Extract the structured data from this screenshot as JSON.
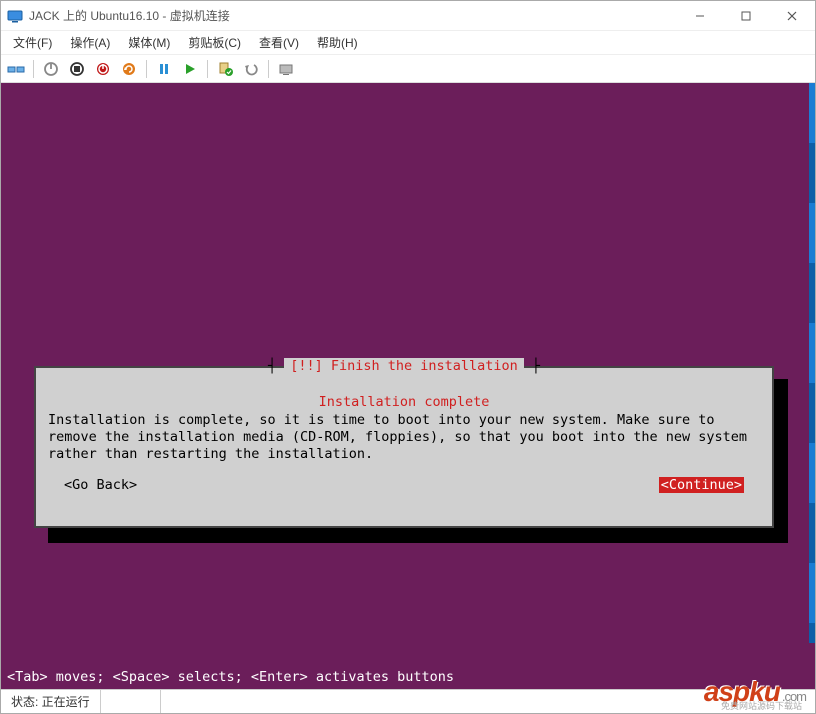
{
  "window": {
    "title": "JACK 上的 Ubuntu16.10 - 虚拟机连接"
  },
  "menu": {
    "file": "文件(F)",
    "operate": "操作(A)",
    "media": "媒体(M)",
    "clipboard": "剪贴板(C)",
    "view": "查看(V)",
    "help": "帮助(H)"
  },
  "installer": {
    "dialog_title": "[!!] Finish the installation",
    "heading": "Installation complete",
    "body": "Installation is complete, so it is time to boot into your new system. Make sure to remove the installation media (CD-ROM, floppies), so that you boot into the new system rather than restarting the installation.",
    "go_back": "<Go Back>",
    "continue": "<Continue>",
    "hint": "<Tab> moves; <Space> selects; <Enter> activates buttons"
  },
  "status": {
    "label": "状态: 正在运行"
  },
  "watermark": {
    "main": "aspku",
    "suffix": ".com",
    "sub": "免费网站源码下载站"
  }
}
